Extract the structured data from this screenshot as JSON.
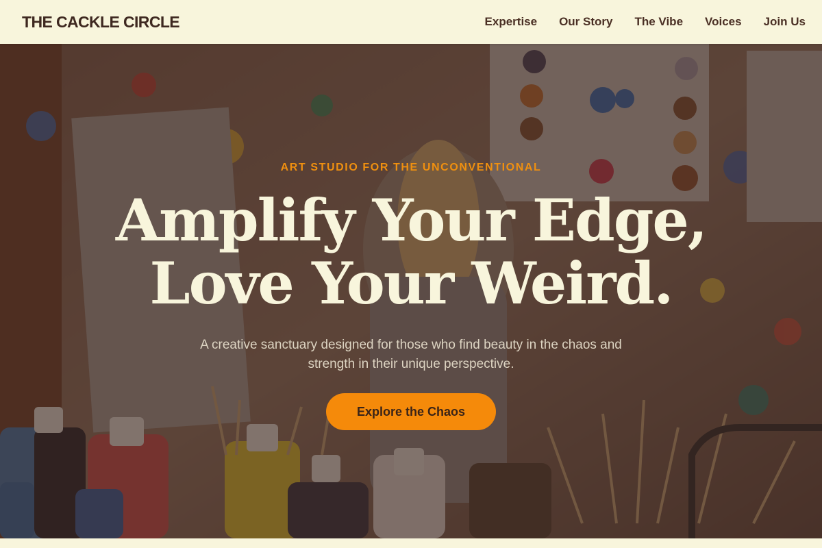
{
  "nav": {
    "brand": "THE CACKLE CIRCLE",
    "links": [
      "Expertise",
      "Our Story",
      "The Vibe",
      "Voices",
      "Join Us"
    ]
  },
  "hero": {
    "eyebrow": "ART STUDIO FOR THE UNCONVENTIONAL",
    "headline_line1": "Amplify Your Edge,",
    "headline_line2": "Love Your Weird.",
    "subtext": "A creative sanctuary designed for those who find beauty in the chaos and strength in their unique perspective.",
    "cta_label": "Explore the Chaos",
    "background_image": "paint-splattered-art-studio-photo"
  },
  "colors": {
    "background": "#f8f5dc",
    "brand_text": "#3e2820",
    "accent": "#f58a0a",
    "headline": "#f8f5dc"
  }
}
